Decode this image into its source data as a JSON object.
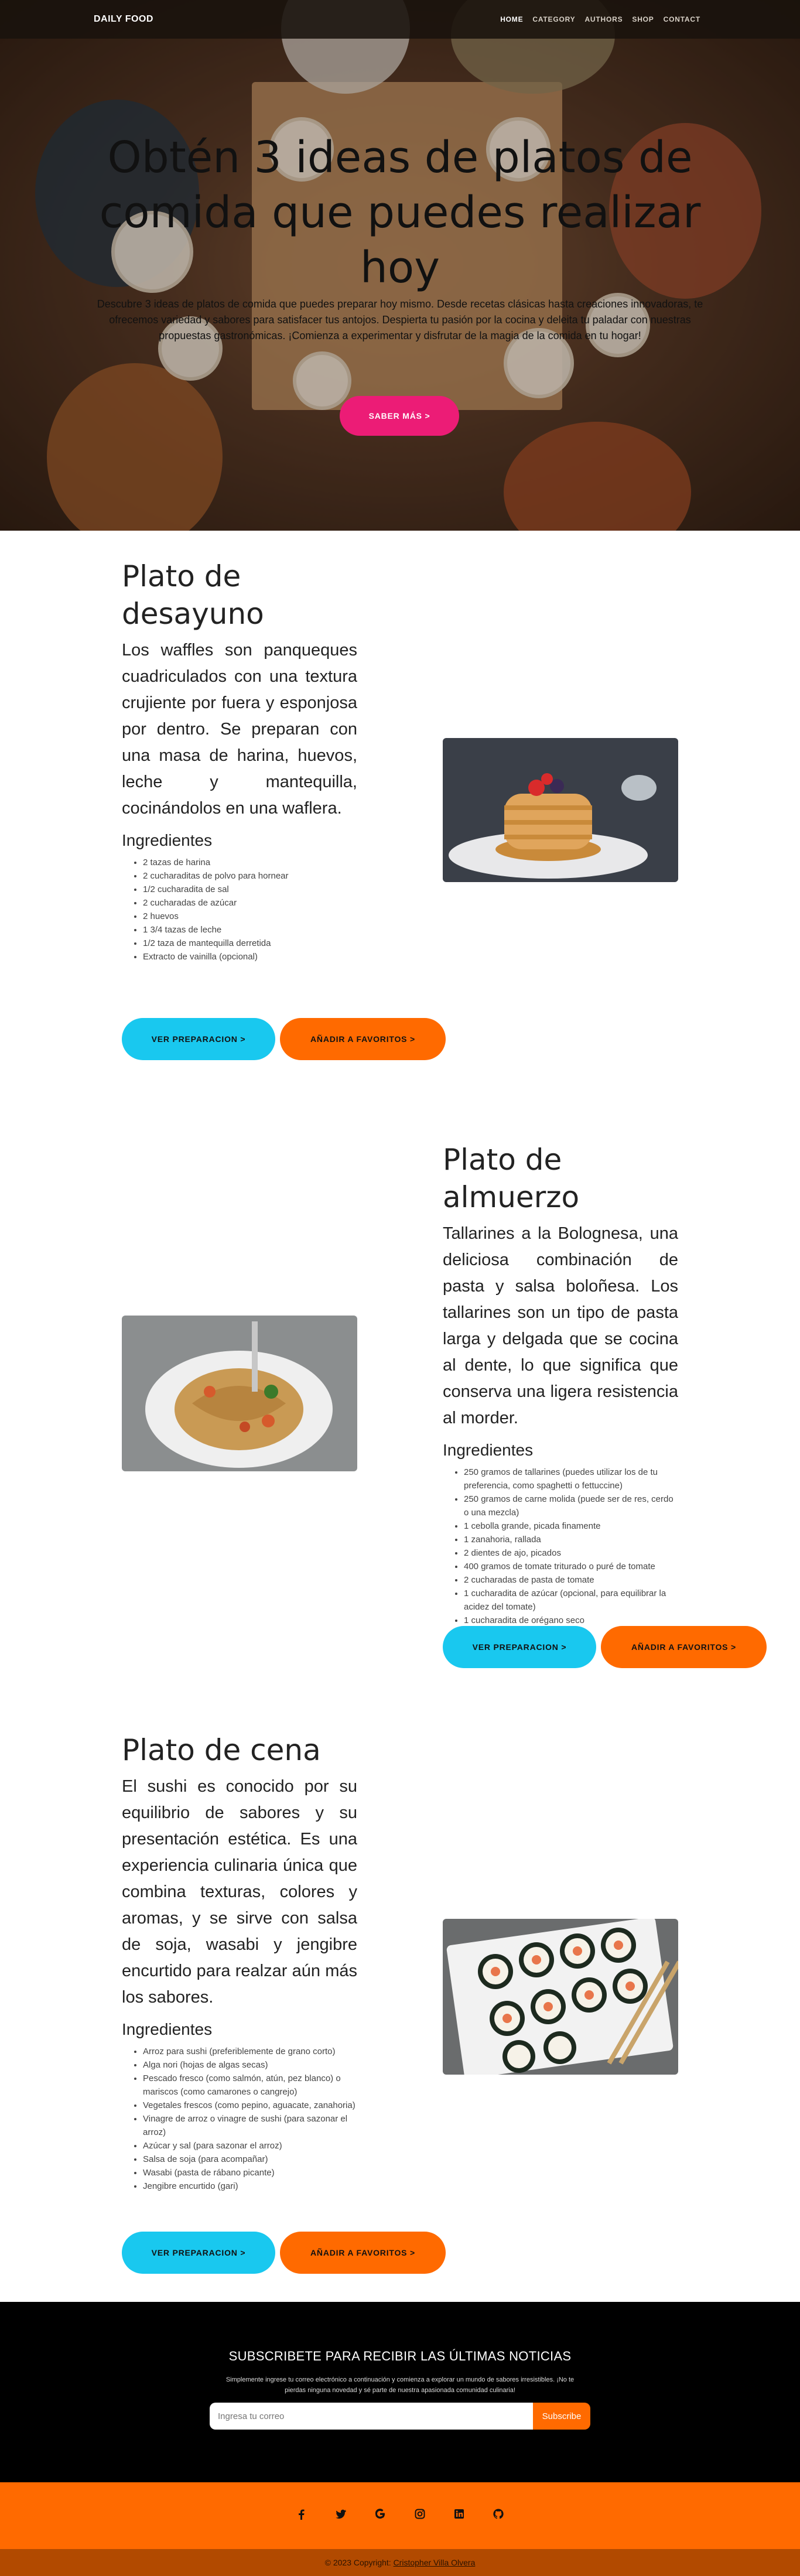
{
  "nav": {
    "brand": "DAILY FOOD",
    "links": [
      "HOME",
      "CATEGORY",
      "AUTHORS",
      "SHOP",
      "CONTACT"
    ]
  },
  "hero": {
    "title": "Obtén 3 ideas de platos de comida que puedes realizar hoy",
    "description": "Descubre 3 ideas de platos de comida que puedes preparar hoy mismo. Desde recetas clásicas hasta creaciones innovadoras, te ofrecemos variedad y sabores para satisfacer tus antojos. Despierta tu pasión por la cocina y deleita tu paladar con nuestras propuestas gastronómicas. ¡Comienza a experimentar y disfrutar de la magia de la comida en tu hogar!",
    "button": "SABER MÁS >"
  },
  "breakfast": {
    "title": "Plato de desayuno",
    "description": "Los waffles son panqueques cuadriculados con una textura crujiente por fuera y esponjosa por dentro. Se preparan con una masa de harina, huevos, leche y mantequilla, cocinándolos en una waflera.",
    "ingredients_title": "Ingredientes",
    "ingredients": [
      "2 tazas de harina",
      "2 cucharaditas de polvo para hornear",
      "1/2 cucharadita de sal",
      "2 cucharadas de azúcar",
      "2 huevos",
      "1 3/4 tazas de leche",
      "1/2 taza de mantequilla derretida",
      "Extracto de vainilla (opcional)"
    ],
    "btn_recipe": "VER PREPARACION >",
    "btn_fav": "AÑADIR A FAVORITOS >"
  },
  "lunch": {
    "title": "Plato de almuerzo",
    "description": "Tallarines a la Bolognesa, una deliciosa combinación de pasta y salsa boloñesa. Los tallarines son un tipo de pasta larga y delgada que se cocina al dente, lo que significa que conserva una ligera resistencia al morder.",
    "ingredients_title": "Ingredientes",
    "ingredients": [
      "250 gramos de tallarines (puedes utilizar los de tu preferencia, como spaghetti o fettuccine)",
      "250 gramos de carne molida (puede ser de res, cerdo o una mezcla)",
      "1 cebolla grande, picada finamente",
      "1 zanahoria, rallada",
      "2 dientes de ajo, picados",
      "400 gramos de tomate triturado o puré de tomate",
      "2 cucharadas de pasta de tomate",
      "1 cucharadita de azúcar (opcional, para equilibrar la acidez del tomate)",
      "1 cucharadita de orégano seco"
    ],
    "btn_recipe": "VER PREPARACION >",
    "btn_fav": "AÑADIR A FAVORITOS >"
  },
  "dinner": {
    "title": "Plato de cena",
    "description": "El sushi es conocido por su equilibrio de sabores y su presentación estética. Es una experiencia culinaria única que combina texturas, colores y aromas, y se sirve con salsa de soja, wasabi y jengibre encurtido para realzar aún más los sabores.",
    "ingredients_title": "Ingredientes",
    "ingredients": [
      "Arroz para sushi (preferiblemente de grano corto)",
      "Alga nori (hojas de algas secas)",
      "Pescado fresco (como salmón, atún, pez blanco) o mariscos (como camarones o cangrejo)",
      "Vegetales frescos (como pepino, aguacate, zanahoria)",
      "Vinagre de arroz o vinagre de sushi (para sazonar el arroz)",
      "Azúcar y sal (para sazonar el arroz)",
      "Salsa de soja (para acompañar)",
      "Wasabi (pasta de rábano picante)",
      "Jengibre encurtido (gari)"
    ],
    "btn_recipe": "VER PREPARACION >",
    "btn_fav": "AÑADIR A FAVORITOS >"
  },
  "newsletter": {
    "title": "SUBSCRIBETE PARA RECIBIR LAS ÚLTIMAS NOTICIAS",
    "text": "Simplemente ingrese tu correo electrónico a continuación y comienza a explorar un mundo de sabores irresistibles. ¡No te pierdas ninguna novedad y sé parte de nuestra apasionada comunidad culinaria!",
    "placeholder": "Ingresa tu correo",
    "button": "Subscribe"
  },
  "footer": {
    "icons": [
      "facebook-icon",
      "twitter-icon",
      "google-icon",
      "instagram-icon",
      "linkedin-icon",
      "github-icon"
    ],
    "copyright": "© 2023 Copyright:",
    "author": "Cristopher Villa Olvera"
  },
  "colors": {
    "accent_pink": "#ec1c76",
    "accent_blue": "#19c8ef",
    "accent_orange": "#ff6a00"
  }
}
